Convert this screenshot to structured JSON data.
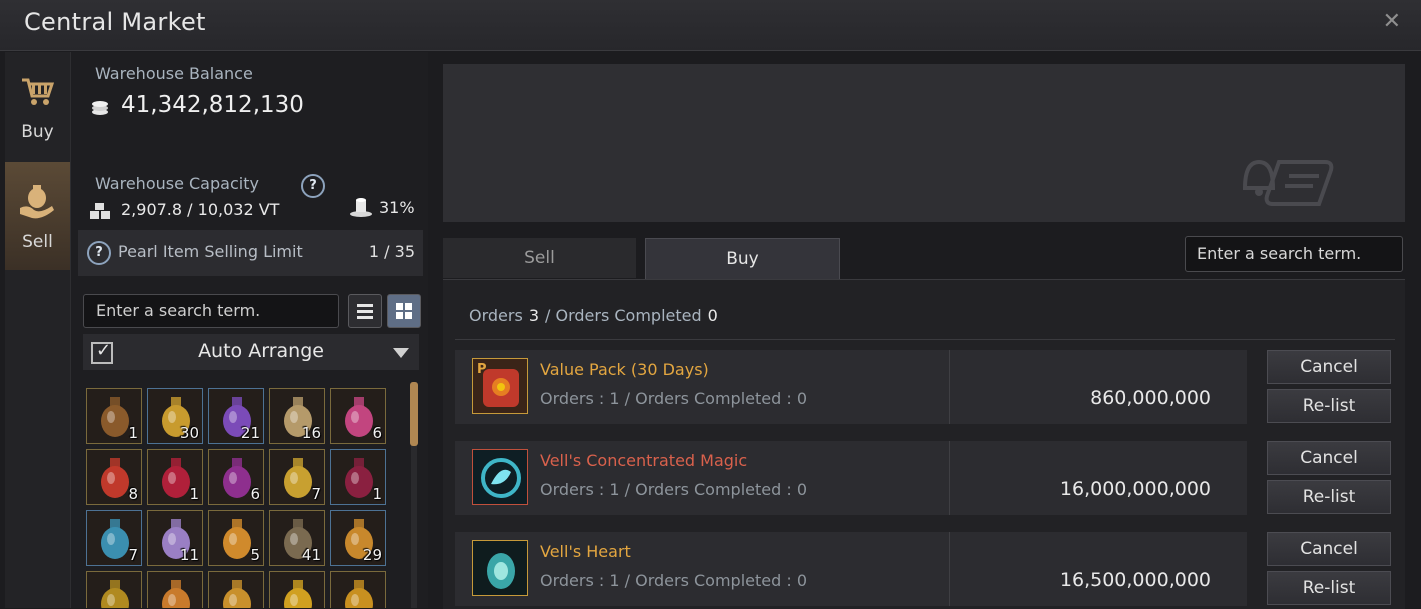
{
  "window": {
    "title": "Central Market",
    "close_glyph": "✕"
  },
  "rail": {
    "tabs": [
      {
        "label": "Buy",
        "icon": "cart-icon"
      },
      {
        "label": "Sell",
        "icon": "money-bag-icon",
        "active": true
      }
    ]
  },
  "left": {
    "balance_label": "Warehouse Balance",
    "balance_value": "41,342,812,130",
    "capacity_label": "Warehouse Capacity",
    "help_glyph": "?",
    "capacity_value": "2,907.8 / 10,032 VT",
    "capacity_percent": "31%",
    "pearl_label": "Pearl Item Selling Limit",
    "pearl_value": "1 / 35",
    "search_placeholder": "Enter a search term.",
    "auto_arrange_label": "Auto Arrange",
    "auto_arrange_checked": true,
    "check_glyph": "✓",
    "inventory": [
      {
        "name": "bow-item",
        "count": "1"
      },
      {
        "name": "gold-ore-item",
        "count": "30"
      },
      {
        "name": "purple-crystal-item",
        "count": "21"
      },
      {
        "name": "food-platter-item",
        "count": "16"
      },
      {
        "name": "pink-potion-item",
        "count": "6"
      },
      {
        "name": "red-potion-item",
        "count": "8"
      },
      {
        "name": "red-elixir-item",
        "count": "1"
      },
      {
        "name": "purple-potion-item",
        "count": "6"
      },
      {
        "name": "gold-charm-item",
        "count": "7"
      },
      {
        "name": "dark-red-potion-item",
        "count": "1"
      },
      {
        "name": "blue-crystal-bottle-item",
        "count": "7"
      },
      {
        "name": "lavender-bottle-item",
        "count": "11"
      },
      {
        "name": "orange-bottle-item",
        "count": "5"
      },
      {
        "name": "ore-chunk-item",
        "count": "41"
      },
      {
        "name": "amber-bottle-item",
        "count": "29"
      },
      {
        "name": "gold-pouch-item",
        "count": ""
      },
      {
        "name": "orange-flask-item",
        "count": ""
      },
      {
        "name": "orange-vial-item",
        "count": ""
      },
      {
        "name": "gold-coin-item",
        "count": ""
      },
      {
        "name": "gold-drop-item",
        "count": ""
      }
    ]
  },
  "right": {
    "tabs": {
      "sell": "Sell",
      "buy": "Buy"
    },
    "search_placeholder": "Enter a search term.",
    "summary": {
      "orders_label": "Orders",
      "orders_value": "3",
      "separator": "/",
      "completed_label": "Orders Completed",
      "completed_value": "0"
    },
    "orders": [
      {
        "name": "Value Pack (30 Days)",
        "sub": "Orders : 1 / Orders Completed : 0",
        "price": "860,000,000",
        "name_color": "#e3a640",
        "cancel": "Cancel",
        "relist": "Re-list"
      },
      {
        "name": "Vell's Concentrated Magic",
        "sub": "Orders : 1 / Orders Completed : 0",
        "price": "16,000,000,000",
        "name_color": "#d9614c",
        "cancel": "Cancel",
        "relist": "Re-list"
      },
      {
        "name": "Vell's Heart",
        "sub": "Orders : 1 / Orders Completed : 0",
        "price": "16,500,000,000",
        "name_color": "#e3a640",
        "cancel": "Cancel",
        "relist": "Re-list"
      }
    ]
  }
}
